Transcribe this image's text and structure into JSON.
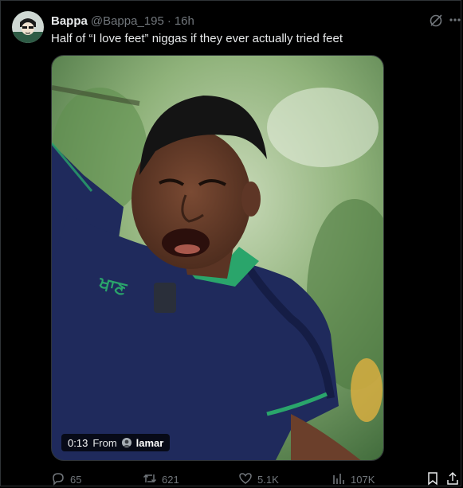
{
  "post": {
    "display_name": "Bappa",
    "handle": "@Bappa_195",
    "separator": "·",
    "time": "16h",
    "text": "Half of “I love feet” niggas if they ever actually tried feet",
    "more_icon": "more-horizontal-icon",
    "grok_icon": "grok-icon"
  },
  "video": {
    "duration": "0:13",
    "from_label": "From",
    "source_user": "lamar",
    "shirt_text": "ਖਾਣ"
  },
  "actions": {
    "replies": "65",
    "reposts": "621",
    "likes": "5.1K",
    "views": "107K",
    "reply_icon": "reply-icon",
    "repost_icon": "repost-icon",
    "like_icon": "heart-icon",
    "views_icon": "views-chart-icon",
    "bookmark_icon": "bookmark-icon",
    "share_icon": "share-icon"
  },
  "colors": {
    "background": "#000000",
    "text": "#e7e9ea",
    "muted": "#71767b",
    "shirt": "#1f2a5c",
    "shirt_trim": "#2aa56b"
  }
}
